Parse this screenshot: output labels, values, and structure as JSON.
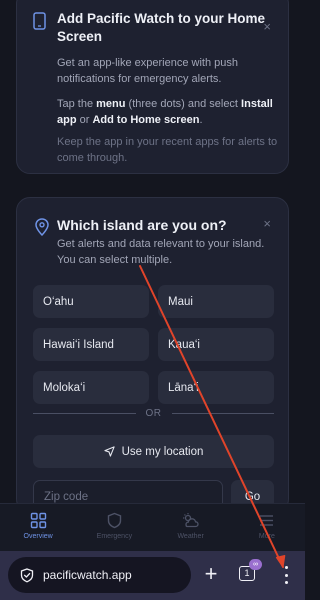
{
  "install_card": {
    "title": "Add Pacific Watch to your Home Screen",
    "desc1": "Get an app-like experience with push notifications for emergency alerts.",
    "desc2_prefix": "Tap the ",
    "desc2_menu": "menu",
    "desc2_middle": " (three dots) and select ",
    "desc2_install": "Install app",
    "desc2_or": " or ",
    "desc2_add": "Add to Home screen",
    "desc2_end": ".",
    "desc3": "Keep the app in your recent apps for alerts to come through.",
    "close_glyph": "×"
  },
  "island_card": {
    "title": "Which island are you on?",
    "desc": "Get alerts and data relevant to your island. You can select multiple.",
    "close_glyph": "×",
    "islands": [
      "O‘ahu",
      "Maui",
      "Hawai‘i Island",
      "Kaua‘i",
      "Moloka‘i",
      "Lāna‘i"
    ],
    "or_label": "OR",
    "use_location_label": "Use my location",
    "zip_placeholder": "Zip code",
    "go_label": "Go"
  },
  "bottom_nav": {
    "items": [
      {
        "label": "Overview",
        "icon": "grid-icon",
        "active": true
      },
      {
        "label": "Emergency",
        "icon": "shield-icon",
        "active": false
      },
      {
        "label": "Weather",
        "icon": "weather-icon",
        "active": false
      },
      {
        "label": "More",
        "icon": "menu-icon",
        "active": false
      }
    ]
  },
  "browser": {
    "url": "pacificwatch.app",
    "tab_count": "1",
    "tab_badge": "∞",
    "plus_glyph": "+"
  },
  "colors": {
    "accent": "#6f93e6",
    "annotation_arrow": "#e0442a",
    "background": "#14161f",
    "card": "#1e2130"
  }
}
